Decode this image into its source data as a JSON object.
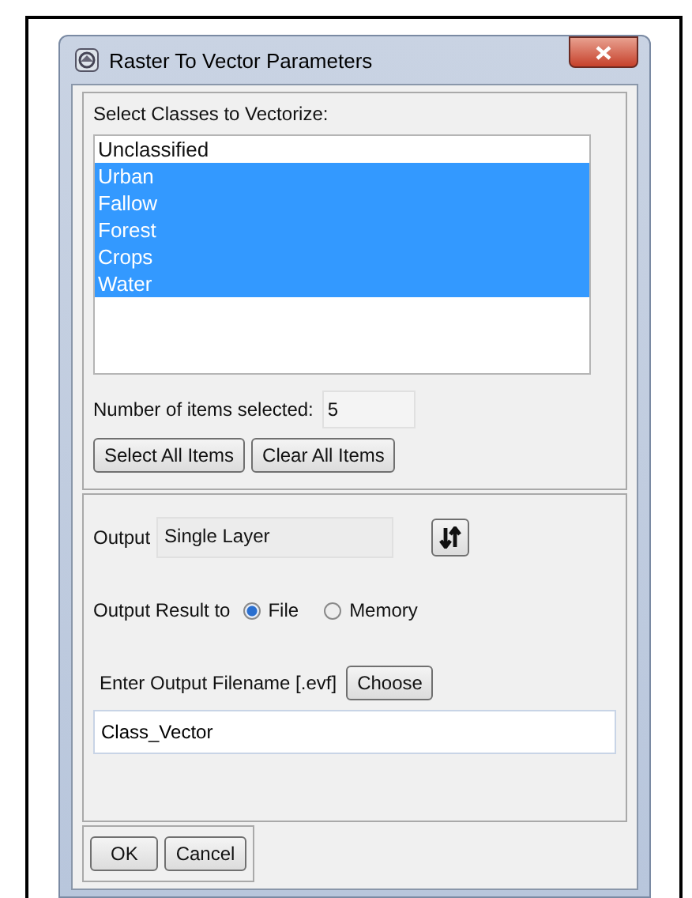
{
  "window": {
    "title": "Raster To Vector Parameters"
  },
  "classes": {
    "label": "Select Classes to Vectorize:",
    "items": [
      {
        "label": "Unclassified",
        "selected": false
      },
      {
        "label": "Urban",
        "selected": true
      },
      {
        "label": "Fallow",
        "selected": true
      },
      {
        "label": "Forest",
        "selected": true
      },
      {
        "label": "Crops",
        "selected": true
      },
      {
        "label": "Water",
        "selected": true
      }
    ],
    "count_label": "Number of items selected:",
    "count": "5",
    "buttons": [
      "Select All Items",
      "Clear All Items"
    ]
  },
  "output": {
    "label": "Output",
    "value": "Single Layer",
    "result_label": "Output Result to",
    "options": [
      {
        "label": "File",
        "selected": true
      },
      {
        "label": "Memory",
        "selected": false
      }
    ],
    "filename_label": "Enter Output Filename [.evf]",
    "choose": "Choose",
    "filename": "Class_Vector"
  },
  "buttons": [
    "OK",
    "Cancel"
  ]
}
